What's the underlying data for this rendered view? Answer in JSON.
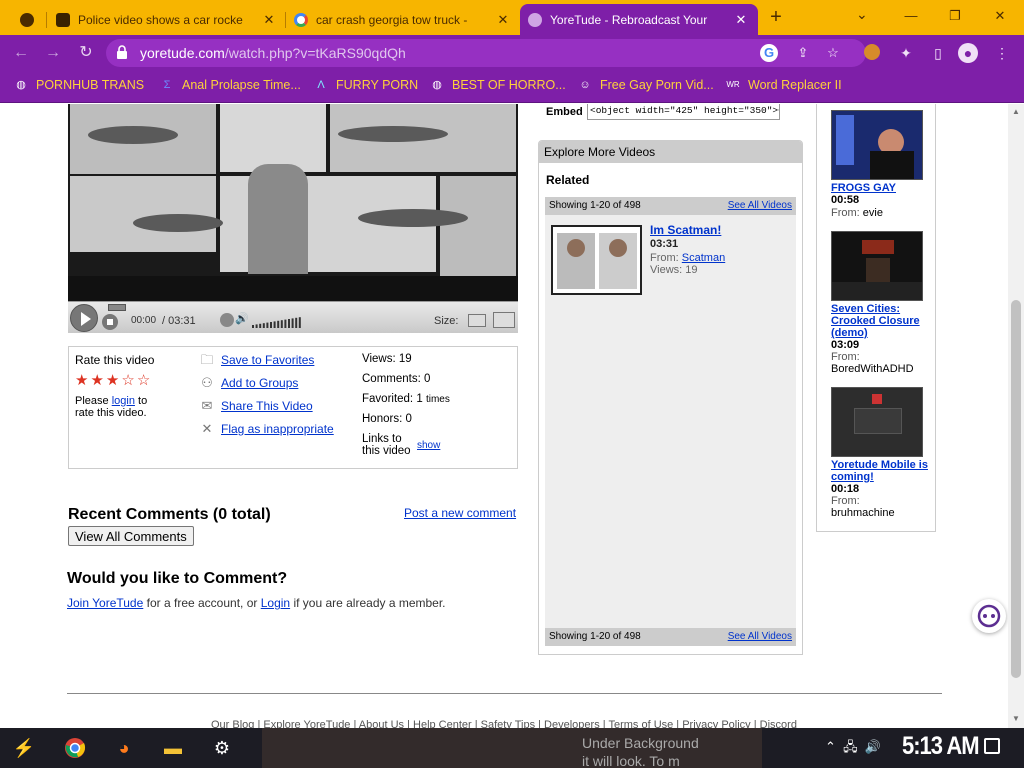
{
  "browser": {
    "tabs": [
      {
        "title": "Police video shows a car rocke",
        "favicon": "car-favicon",
        "active": false
      },
      {
        "title": "car crash georgia tow truck - ",
        "favicon": "google-favicon",
        "active": false
      },
      {
        "title": "YoreTude - Rebroadcast Your",
        "favicon": "globe-favicon",
        "active": true
      }
    ],
    "new_tab": "+",
    "url_host": "yoretude.com",
    "url_path": "/watch.php?v=tKaRS90qdQh",
    "bookmarks": [
      {
        "label": "PORNHUB TRANS",
        "icon": "globe-icon"
      },
      {
        "label": "Anal Prolapse Time...",
        "icon": "sigma-icon"
      },
      {
        "label": "FURRY PORN",
        "icon": "arrow-a-icon"
      },
      {
        "label": "BEST OF HORRO...",
        "icon": "globe-icon"
      },
      {
        "label": "Free Gay Porn Vid...",
        "icon": "face-icon"
      },
      {
        "label": "Word Replacer II",
        "icon": "wr-icon"
      }
    ],
    "colors": {
      "tabbar": "#f7b500",
      "toolbar": "#7e1fa8",
      "bookmark_text": "#ffd23a"
    }
  },
  "player": {
    "current_time": "00:00",
    "duration": "/ 03:31",
    "size_label": "Size:",
    "volume_level": 0.95
  },
  "stats": {
    "rate_label": "Rate this video",
    "stars_filled": 3,
    "stars_total": 5,
    "login_prefix": "Please",
    "login_link": "login",
    "login_suffix": "to rate this video.",
    "actions": [
      {
        "label": "Save to Favorites",
        "icon": "folder-icon"
      },
      {
        "label": "Add to Groups",
        "icon": "group-icon"
      },
      {
        "label": "Share This Video",
        "icon": "envelope-icon"
      },
      {
        "label": "Flag as inappropriate",
        "icon": "flag-x-icon"
      }
    ],
    "views": "Views: 19",
    "comments": "Comments: 0",
    "favorited": "Favorited: 1",
    "favorited_suffix": "times",
    "honors": "Honors: 0",
    "links_label": "Links to this video",
    "links_show": "show"
  },
  "comments": {
    "title": "Recent Comments (0 total)",
    "post_link": "Post a new comment",
    "view_all": "View All Comments",
    "prompt": "Would you like to Comment?",
    "join_link": "Join YoreTude",
    "join_mid": "for a free account, or",
    "login_link": "Login",
    "join_end": "if you are already a member."
  },
  "footer": {
    "links": "Our Blog | Explore YoreTude | About Us | Help Center | Safety Tips | Developers | Terms of Use | Privacy Policy | Discord"
  },
  "embed": {
    "label": "Embed",
    "code": "<object width=\"425\" height=\"350\"><param"
  },
  "explore": {
    "header": "Explore More Videos",
    "related_label": "Related",
    "showing": "Showing 1-20 of 498",
    "see_all": "See All Videos",
    "video": {
      "title": "Im Scatman!",
      "duration": "03:31",
      "from_label": "From:",
      "from_user": "Scatman",
      "views": "Views: 19"
    }
  },
  "sidebar": {
    "videos": [
      {
        "title": "FROGS GAY",
        "duration": "00:58",
        "from_label": "From:",
        "user": "evie"
      },
      {
        "title": "Seven Cities: Crooked Closure (demo)",
        "duration": "03:09",
        "from_label": "From:",
        "user": "BoredWithADHD"
      },
      {
        "title": "Yoretude Mobile is coming!",
        "duration": "00:18",
        "from_label": "From:",
        "user": "bruhmachine"
      }
    ]
  },
  "taskbar": {
    "preview_line1": "Under Background",
    "preview_line2": "it will look. To m",
    "clock": "5:13 AM"
  }
}
